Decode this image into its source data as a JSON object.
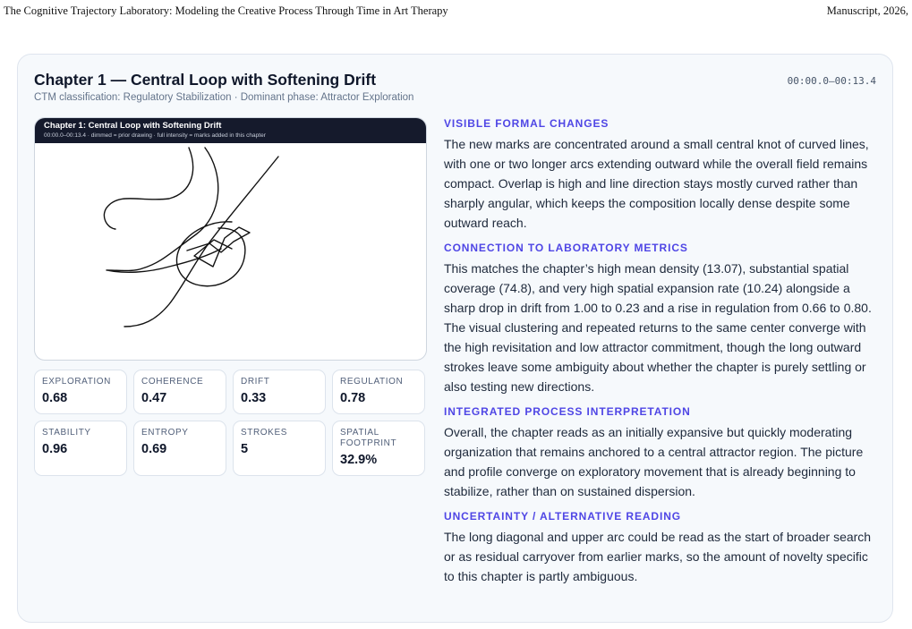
{
  "running_header": {
    "left": "The Cognitive Trajectory Laboratory: Modeling the Creative Process Through Time in Art Therapy",
    "right": "Manuscript, 2026,"
  },
  "chapter": {
    "title": "Chapter 1 — Central Loop with Softening Drift",
    "subtitle": "CTM classification: Regulatory Stabilization · Dominant phase: Attractor Exploration",
    "timecode": "00:00.0–00:13.4"
  },
  "drawing": {
    "header_title": "Chapter 1: Central Loop with Softening Drift",
    "header_sub": "00:00.0–00:13.4  ·  dimmed = prior drawing  ·  full intensity = marks added in this chapter"
  },
  "metrics": [
    {
      "label": "EXPLORATION",
      "value": "0.68"
    },
    {
      "label": "COHERENCE",
      "value": "0.47"
    },
    {
      "label": "DRIFT",
      "value": "0.33"
    },
    {
      "label": "REGULATION",
      "value": "0.78"
    },
    {
      "label": "STABILITY",
      "value": "0.96"
    },
    {
      "label": "ENTROPY",
      "value": "0.69"
    },
    {
      "label": "STROKES",
      "value": "5"
    },
    {
      "label": "SPATIAL FOOTPRINT",
      "value": "32.9%"
    }
  ],
  "sections": [
    {
      "heading": "VISIBLE FORMAL CHANGES",
      "body": "The new marks are concentrated around a small central knot of curved lines, with one or two longer arcs extending outward while the overall field remains compact. Overlap is high and line direction stays mostly curved rather than sharply angular, which keeps the composition locally dense despite some outward reach."
    },
    {
      "heading": "CONNECTION TO LABORATORY METRICS",
      "body": "This matches the chapter’s high mean density (13.07), substantial spatial coverage (74.8), and very high spatial expansion rate (10.24) alongside a sharp drop in drift from 1.00 to 0.23 and a rise in regulation from 0.66 to 0.80. The visual clustering and repeated returns to the same center converge with the high revisitation and low attractor commitment, though the long outward strokes leave some ambiguity about whether the chapter is purely settling or also testing new directions."
    },
    {
      "heading": "INTEGRATED PROCESS INTERPRETATION",
      "body": "Overall, the chapter reads as an initially expansive but quickly moderating organization that remains anchored to a central attractor region. The picture and profile converge on exploratory movement that is already beginning to stabilize, rather than on sustained dispersion."
    },
    {
      "heading": "UNCERTAINTY / ALTERNATIVE READING",
      "body": "The long diagonal and upper arc could be read as the start of broader search or as residual carryover from earlier marks, so the amount of novelty specific to this chapter is partly ambiguous."
    }
  ]
}
